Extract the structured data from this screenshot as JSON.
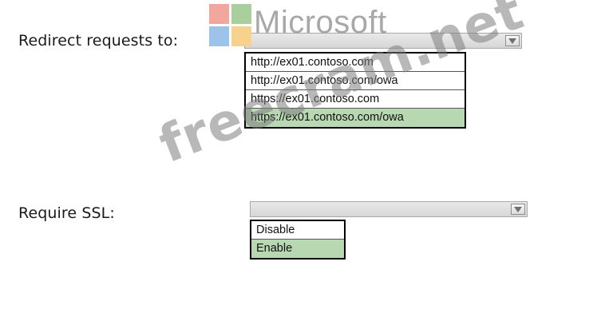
{
  "redirect": {
    "label": "Redirect requests to:",
    "options": [
      "http://ex01.contoso.com",
      "http://ex01.contoso.com/owa",
      "https://ex01.contoso.com",
      "https://ex01.contoso.com/owa"
    ],
    "selected_index": 3
  },
  "ssl": {
    "label": "Require SSL:",
    "options": [
      "Disable",
      "Enable"
    ],
    "selected_index": 1
  },
  "watermark": {
    "logo_text": "Microsoft",
    "site_text": "freecram.net"
  },
  "colors": {
    "selected_bg": "#b8d8b2",
    "logo_red": "#f1a79d",
    "logo_green": "#a9cf9e",
    "logo_blue": "#9cc3ea",
    "logo_yellow": "#f6d28d"
  },
  "icons": {
    "dropdown_arrow": "chevron-down-icon"
  }
}
